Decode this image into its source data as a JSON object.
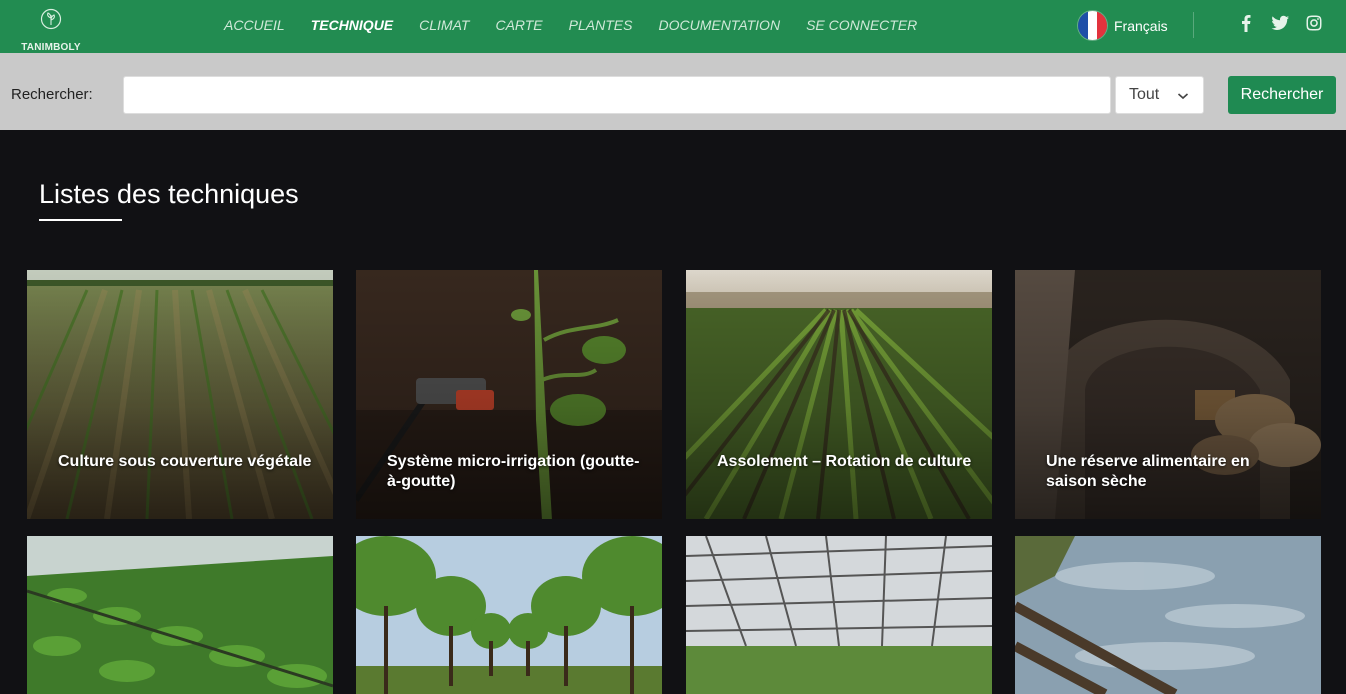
{
  "brand": {
    "name": "TANIMBOLY"
  },
  "nav": {
    "items": [
      {
        "label": "ACCUEIL"
      },
      {
        "label": "TECHNIQUE"
      },
      {
        "label": "CLIMAT"
      },
      {
        "label": "CARTE"
      },
      {
        "label": "PLANTES"
      },
      {
        "label": "DOCUMENTATION"
      },
      {
        "label": "SE CONNECTER"
      }
    ],
    "active": "TECHNIQUE",
    "language": "Français",
    "socials": [
      "facebook-icon",
      "twitter-icon",
      "instagram-icon"
    ]
  },
  "search": {
    "label": "Rechercher:",
    "value": "",
    "placeholder": "",
    "filter_selected": "Tout",
    "button_label": "Rechercher"
  },
  "main": {
    "title": "Listes des techniques",
    "cards": [
      {
        "title": "Culture sous couverture végétale"
      },
      {
        "title": "Système micro-irrigation (goutte-à-goutte)"
      },
      {
        "title": "Assolement – Rotation de culture"
      },
      {
        "title": "Une réserve alimentaire en saison sèche"
      },
      {
        "title": ""
      },
      {
        "title": ""
      },
      {
        "title": ""
      },
      {
        "title": ""
      }
    ]
  },
  "colors": {
    "primary_green": "#228c51",
    "button_green": "#1f8a52",
    "page_background": "#111114",
    "search_bar_background": "#c9c9c9"
  }
}
